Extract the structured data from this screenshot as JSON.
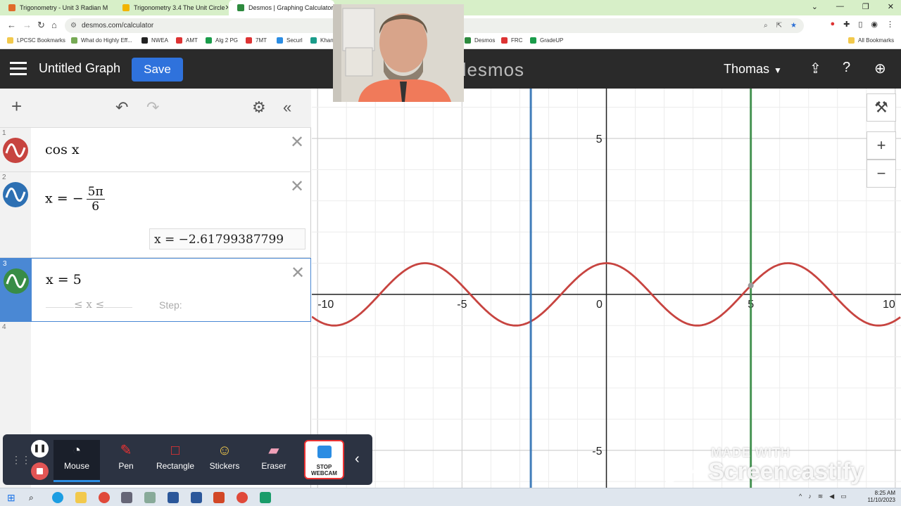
{
  "browser": {
    "tabs": [
      {
        "label": "Trigonometry - Unit 3 Radian M",
        "color": "#e06b2b"
      },
      {
        "label": "Trigonometry 3.4 The Unit Circle",
        "color": "#f2b400"
      },
      {
        "label": "Desmos | Graphing Calculator",
        "color": "#2d8a3e"
      }
    ],
    "url": "desmos.com/calculator",
    "bookmarks": [
      "LPCSC Bookmarks",
      "What do Highly Eff...",
      "NWEA",
      "AMT",
      "Alg 2 PG",
      "7MT",
      "Securl",
      "Khan",
      "Desmos",
      "FRC",
      "GradeUP"
    ],
    "all_bookmarks": "All Bookmarks"
  },
  "header": {
    "title": "Untitled Graph",
    "save_label": "Save",
    "logo": "desmos",
    "user": "Thomas"
  },
  "expressions": [
    {
      "num": "1",
      "color": "#c74440",
      "text": "cos x"
    },
    {
      "num": "2",
      "color": "#2d70b3",
      "lhs": "x = −",
      "frac_num": "5π",
      "frac_den": "6",
      "eval": "x  =  −2.61799387799"
    },
    {
      "num": "3",
      "color": "#388c46",
      "text": "x = 5",
      "range": "≤ x ≤",
      "step_label": "Step:"
    },
    {
      "num": "4"
    }
  ],
  "graph": {
    "x_ticks": [
      "-10",
      "-5",
      "0",
      "5",
      "10"
    ],
    "y_ticks": [
      "5",
      "-5"
    ],
    "zoom_in": "+",
    "zoom_out": "−"
  },
  "chart_data": {
    "type": "line",
    "xlim": [
      -10.2,
      10.2
    ],
    "ylim": [
      -6.2,
      6.6
    ],
    "grid": true,
    "series": [
      {
        "name": "cos x",
        "color": "#c74440",
        "function": "cos(x)"
      },
      {
        "name": "x = -5π/6",
        "color": "#2d70b3",
        "vertical_x": -2.61799387799
      },
      {
        "name": "x = 5",
        "color": "#388c46",
        "vertical_x": 5
      }
    ]
  },
  "screencastify": {
    "tools": [
      "Mouse",
      "Pen",
      "Rectangle",
      "Stickers",
      "Eraser"
    ],
    "webcam_label": "STOP WEBCAM",
    "watermark_small": "MADE WITH",
    "watermark_big": "Screencastify"
  },
  "taskbar": {
    "time": "8:25 AM",
    "date": "11/10/2023"
  }
}
